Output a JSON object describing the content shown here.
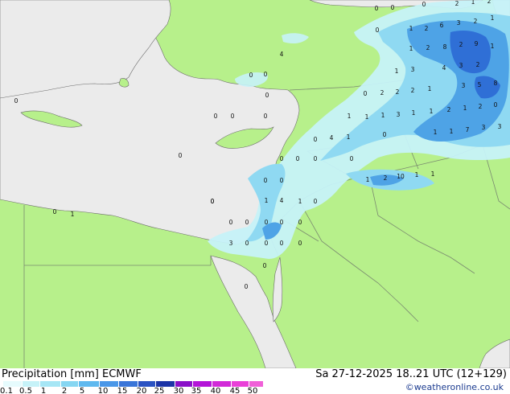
{
  "colors": {
    "land": "#b7f08b",
    "sea": "#ebebeb",
    "border": "#7a8a70",
    "coast": "#6b6b6b",
    "precip_light": "#c6f2f8",
    "precip_mid": "#8fd9f2",
    "precip_heavy": "#4ea3e6",
    "precip_max": "#2f6fd6"
  },
  "footer": {
    "title": "Precipitation [mm]  ECMWF",
    "datetime": "Sa 27-12-2025 18..21 UTC (12+129)",
    "credit": "©weatheronline.co.uk"
  },
  "legend": {
    "ticks": [
      "0.1",
      "0.5",
      "1",
      "2",
      "5",
      "10",
      "15",
      "20",
      "25",
      "30",
      "35",
      "40",
      "45",
      "50"
    ],
    "colors": [
      "#e6fbfd",
      "#c6f2f8",
      "#a6e6f5",
      "#86d6f2",
      "#5fb9ef",
      "#4a97e8",
      "#3a75d8",
      "#2a52c2",
      "#1c34a6",
      "#8a10c8",
      "#b414d8",
      "#d22ad8",
      "#ea40d8",
      "#f060d8"
    ]
  },
  "map_values": [
    {
      "t": "0"
    },
    {
      "t": "0"
    },
    {
      "t": "2"
    },
    {
      "t": "1"
    },
    {
      "t": "2"
    },
    {
      "t": "0"
    },
    {
      "t": "1"
    },
    {
      "t": "2"
    },
    {
      "t": "6"
    },
    {
      "t": "3"
    },
    {
      "t": "2"
    },
    {
      "t": "1"
    },
    {
      "t": "1"
    },
    {
      "t": "2"
    },
    {
      "t": "8"
    },
    {
      "t": "2"
    },
    {
      "t": "9"
    },
    {
      "t": "1"
    },
    {
      "t": "1"
    },
    {
      "t": "3"
    },
    {
      "t": "4"
    },
    {
      "t": "3"
    },
    {
      "t": "2"
    },
    {
      "t": "0"
    },
    {
      "t": "2"
    },
    {
      "t": "2"
    },
    {
      "t": "2"
    },
    {
      "t": "1"
    },
    {
      "t": "3"
    },
    {
      "t": "5"
    },
    {
      "t": "8"
    },
    {
      "t": "1"
    },
    {
      "t": "1"
    },
    {
      "t": "3"
    },
    {
      "t": "1"
    },
    {
      "t": "1"
    },
    {
      "t": "2"
    },
    {
      "t": "1"
    },
    {
      "t": "2"
    },
    {
      "t": "0"
    },
    {
      "t": "1"
    },
    {
      "t": "1"
    },
    {
      "t": "7"
    },
    {
      "t": "3"
    },
    {
      "t": "3"
    },
    {
      "t": "1"
    },
    {
      "t": "2"
    },
    {
      "t": "10"
    },
    {
      "t": "1"
    },
    {
      "t": "1"
    },
    {
      "t": "0"
    },
    {
      "t": "0"
    },
    {
      "t": "0"
    },
    {
      "t": "0"
    },
    {
      "t": "0"
    },
    {
      "t": "4"
    },
    {
      "t": "0"
    },
    {
      "t": "0"
    },
    {
      "t": "0"
    },
    {
      "t": "4"
    },
    {
      "t": "1"
    },
    {
      "t": "1"
    },
    {
      "t": "0"
    },
    {
      "t": "0"
    },
    {
      "t": "0"
    },
    {
      "t": "0"
    },
    {
      "t": "0"
    },
    {
      "t": "0"
    },
    {
      "t": "0"
    },
    {
      "t": "1"
    },
    {
      "t": "4"
    },
    {
      "t": "1"
    },
    {
      "t": "0"
    },
    {
      "t": "0"
    },
    {
      "t": "0"
    },
    {
      "t": "0"
    },
    {
      "t": "0"
    },
    {
      "t": "0"
    },
    {
      "t": "0"
    },
    {
      "t": "0"
    },
    {
      "t": "3"
    },
    {
      "t": "0"
    },
    {
      "t": "0"
    },
    {
      "t": "0"
    },
    {
      "t": "0"
    },
    {
      "t": "0"
    },
    {
      "t": "0"
    },
    {
      "t": "1"
    },
    {
      "t": "0"
    },
    {
      "t": "0"
    },
    {
      "t": "0"
    },
    {
      "t": "0"
    },
    {
      "t": "0"
    },
    {
      "t": "0"
    },
    {
      "t": "1"
    }
  ]
}
